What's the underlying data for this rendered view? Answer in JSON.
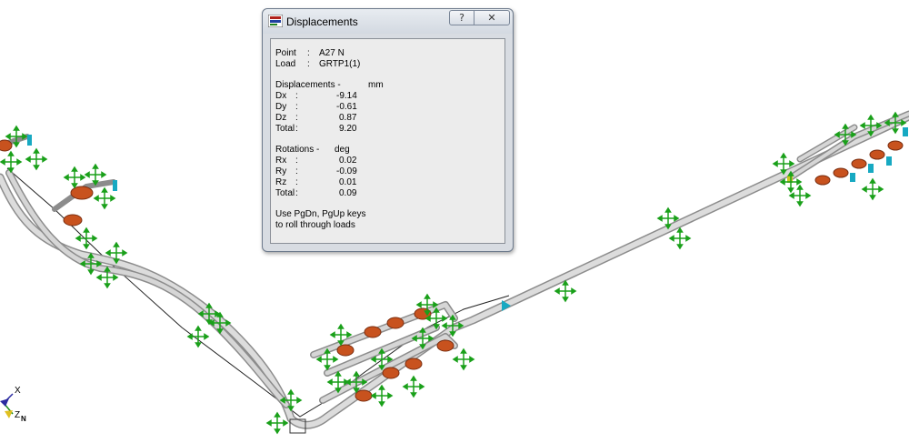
{
  "dialog": {
    "title": "Displacements",
    "help_label": "?",
    "close_label": "✕",
    "point_label": "Point",
    "point_value": "A27 N",
    "load_label": "Load",
    "load_value": "GRTP1(1)",
    "sep": ":",
    "displacements_header": "Displacements -",
    "displacements_unit": "mm",
    "displacements": [
      {
        "label": "Dx",
        "value": "-9.14"
      },
      {
        "label": "Dy",
        "value": "-0.61"
      },
      {
        "label": "Dz",
        "value": "0.87"
      },
      {
        "label": "Total",
        "value": "9.20"
      }
    ],
    "rotations_header": "Rotations -",
    "rotations_unit": "deg",
    "rotations": [
      {
        "label": "Rx",
        "value": "0.02"
      },
      {
        "label": "Ry",
        "value": "-0.09"
      },
      {
        "label": "Rz",
        "value": "0.01"
      },
      {
        "label": "Total",
        "value": "0.09"
      }
    ],
    "hint_line1": "Use PgDn, PgUp keys",
    "hint_line2": "to roll through loads"
  },
  "axis_triad": {
    "x_label": "X",
    "z_label": "Z",
    "n_label": "N"
  },
  "colors": {
    "pipe": "#c9c9c9",
    "pipe_edge": "#8c8c8c",
    "support": "#1aa01a",
    "valve": "#c8521e",
    "anchor": "#17a9c2",
    "dialog_bg": "#d8dce2"
  }
}
